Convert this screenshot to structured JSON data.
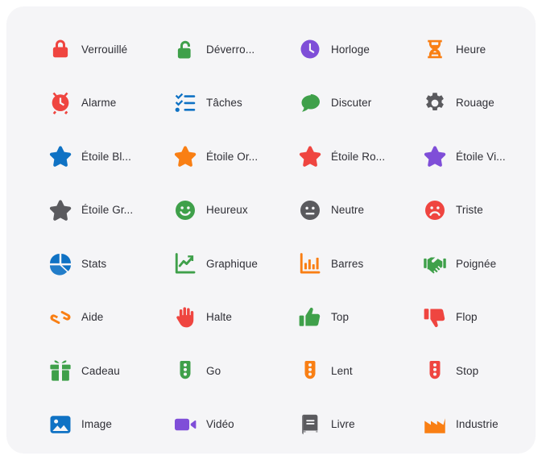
{
  "card": {
    "background_color": "#f5f5f7",
    "page_background": "#ffffff",
    "corner_radius": "22px"
  },
  "palette": {
    "red": "#ef4540",
    "green": "#3fa04a",
    "blue": "#0f72c4",
    "orange": "#f97f14",
    "purple": "#7f4ed8",
    "gray": "#5a5a5e",
    "label_text": "#2e2e35"
  },
  "grid": {
    "columns": 4,
    "rows": 8
  },
  "icons": [
    {
      "name": "lock-icon",
      "label": "Verrouillé",
      "color": "#ef4540",
      "shape": "lock"
    },
    {
      "name": "unlock-icon",
      "label": "Déverro...",
      "color": "#3fa04a",
      "shape": "unlock"
    },
    {
      "name": "clock-icon",
      "label": "Horloge",
      "color": "#7f4ed8",
      "shape": "clock"
    },
    {
      "name": "hourglass-icon",
      "label": "Heure",
      "color": "#f97f14",
      "shape": "hourglass"
    },
    {
      "name": "alarm-clock-icon",
      "label": "Alarme",
      "color": "#ef4540",
      "shape": "alarm"
    },
    {
      "name": "tasks-checklist-icon",
      "label": "Tâches",
      "color": "#0f72c4",
      "shape": "tasks"
    },
    {
      "name": "chat-bubble-icon",
      "label": "Discuter",
      "color": "#3fa04a",
      "shape": "chat"
    },
    {
      "name": "gear-icon",
      "label": "Rouage",
      "color": "#5a5a5e",
      "shape": "gear"
    },
    {
      "name": "star-blue-icon",
      "label": "Étoile Bl...",
      "color": "#0f72c4",
      "shape": "star"
    },
    {
      "name": "star-orange-icon",
      "label": "Étoile Or...",
      "color": "#f97f14",
      "shape": "star"
    },
    {
      "name": "star-red-icon",
      "label": "Étoile Ro...",
      "color": "#ef4540",
      "shape": "star"
    },
    {
      "name": "star-purple-icon",
      "label": "Étoile Vi...",
      "color": "#7f4ed8",
      "shape": "star"
    },
    {
      "name": "star-gray-icon",
      "label": "Étoile Gr...",
      "color": "#5a5a5e",
      "shape": "star"
    },
    {
      "name": "happy-face-icon",
      "label": "Heureux",
      "color": "#3fa04a",
      "shape": "smiley-happy"
    },
    {
      "name": "neutral-face-icon",
      "label": "Neutre",
      "color": "#5a5a5e",
      "shape": "smiley-neutral"
    },
    {
      "name": "sad-face-icon",
      "label": "Triste",
      "color": "#ef4540",
      "shape": "smiley-sad"
    },
    {
      "name": "pie-chart-icon",
      "label": "Stats",
      "color": "#0f72c4",
      "shape": "pie"
    },
    {
      "name": "line-chart-icon",
      "label": "Graphique",
      "color": "#3fa04a",
      "shape": "line-chart"
    },
    {
      "name": "bar-chart-icon",
      "label": "Barres",
      "color": "#f97f14",
      "shape": "bar-chart"
    },
    {
      "name": "handshake-icon",
      "label": "Poignée",
      "color": "#3fa04a",
      "shape": "handshake"
    },
    {
      "name": "helping-hands-icon",
      "label": "Aide",
      "color": "#f97f14",
      "shape": "help-hands"
    },
    {
      "name": "stop-hand-icon",
      "label": "Halte",
      "color": "#ef4540",
      "shape": "hand"
    },
    {
      "name": "thumbs-up-icon",
      "label": "Top",
      "color": "#3fa04a",
      "shape": "thumb-up"
    },
    {
      "name": "thumbs-down-icon",
      "label": "Flop",
      "color": "#ef4540",
      "shape": "thumb-down"
    },
    {
      "name": "gift-icon",
      "label": "Cadeau",
      "color": "#3fa04a",
      "shape": "gift"
    },
    {
      "name": "traffic-light-go-icon",
      "label": "Go",
      "color": "#3fa04a",
      "shape": "traffic"
    },
    {
      "name": "traffic-light-slow-icon",
      "label": "Lent",
      "color": "#f97f14",
      "shape": "traffic"
    },
    {
      "name": "traffic-light-stop-icon",
      "label": "Stop",
      "color": "#ef4540",
      "shape": "traffic"
    },
    {
      "name": "image-icon",
      "label": "Image",
      "color": "#0f72c4",
      "shape": "image"
    },
    {
      "name": "video-camera-icon",
      "label": "Vidéo",
      "color": "#7f4ed8",
      "shape": "video"
    },
    {
      "name": "book-icon",
      "label": "Livre",
      "color": "#5a5a5e",
      "shape": "book"
    },
    {
      "name": "factory-icon",
      "label": "Industrie",
      "color": "#f97f14",
      "shape": "factory"
    }
  ]
}
